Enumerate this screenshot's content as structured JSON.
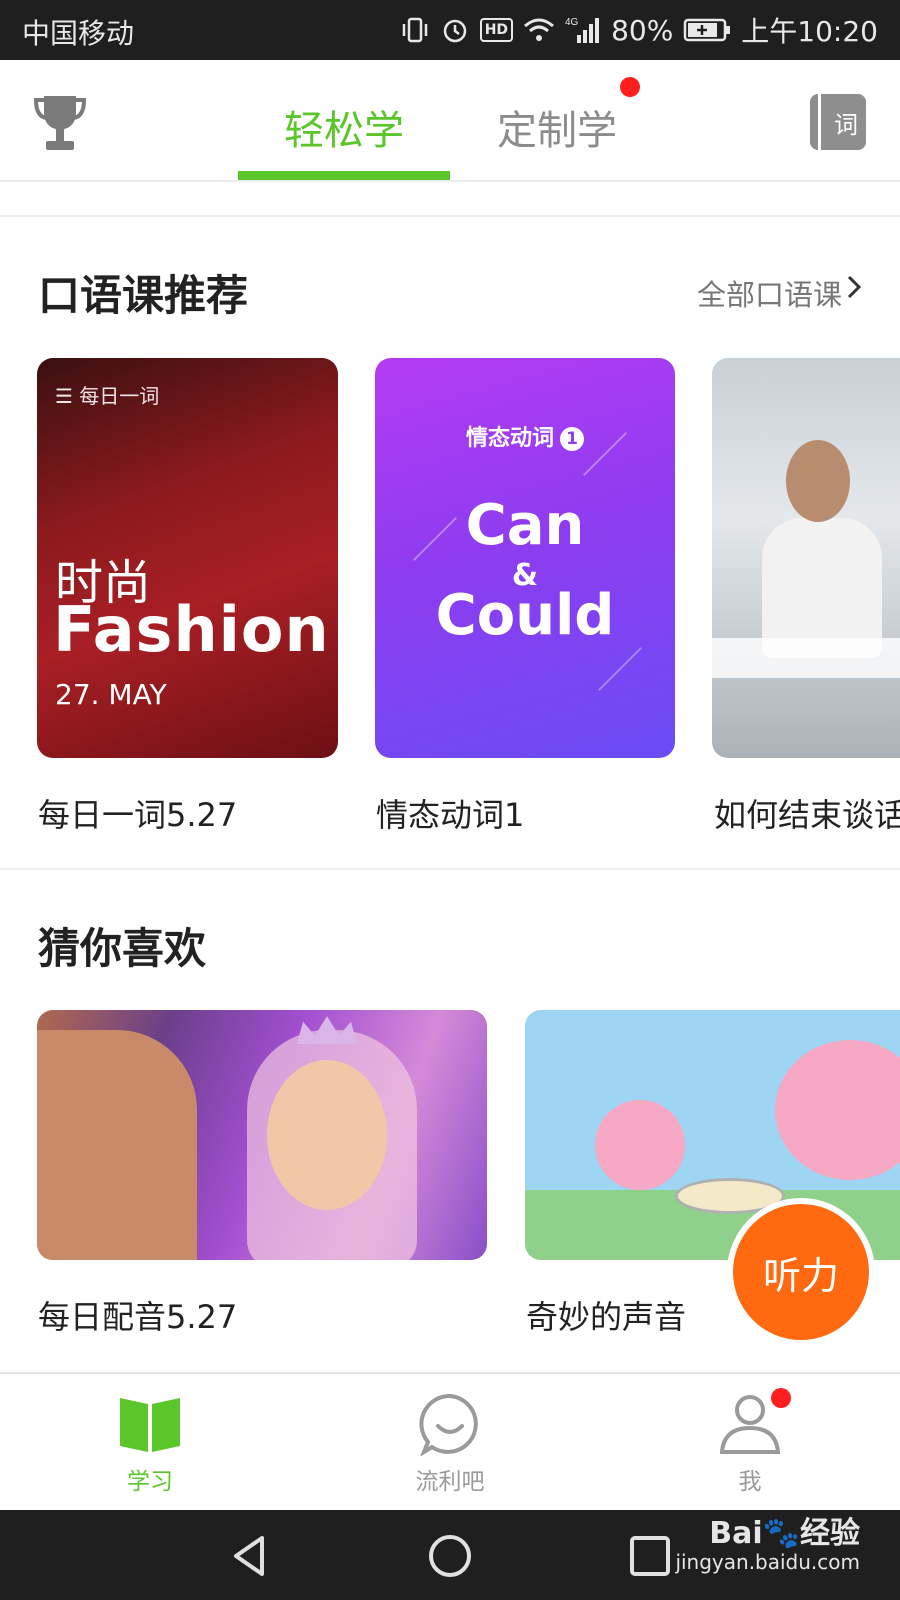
{
  "status_bar": {
    "carrier": "中国移动",
    "network": "4G",
    "hd": "HD",
    "battery": "80%",
    "time": "上午10:20"
  },
  "header": {
    "tabs": [
      {
        "label": "轻松学",
        "active": true
      },
      {
        "label": "定制学",
        "active": false,
        "has_badge": true
      }
    ],
    "vocab_button": "词"
  },
  "speaking_section": {
    "title": "口语课推荐",
    "all_link": "全部口语课",
    "cards": [
      {
        "caption": "每日一词5.27",
        "tag": "☰ 每日一词",
        "title_cn": "时尚",
        "title_en": "Fashion",
        "date": "27. MAY"
      },
      {
        "caption": "情态动词1",
        "tag": "情态动词",
        "tag_number": "1",
        "word1": "Can",
        "amp": "&",
        "word2": "Could"
      },
      {
        "caption": "如何结束谈话"
      }
    ]
  },
  "guess_section": {
    "title": "猜你喜欢",
    "cards": [
      {
        "caption": "每日配音5.27"
      },
      {
        "caption": "奇妙的声音"
      }
    ],
    "floating_button": "听力"
  },
  "bottom_nav": {
    "items": [
      {
        "label": "学习",
        "icon": "book-icon",
        "active": true
      },
      {
        "label": "流利吧",
        "icon": "chat-smile-icon",
        "active": false
      },
      {
        "label": "我",
        "icon": "user-icon",
        "active": false,
        "has_badge": true
      }
    ]
  },
  "watermark": {
    "main": "Bai🐾经验",
    "sub": "jingyan.baidu.com"
  },
  "colors": {
    "accent": "#5ac62a",
    "badge": "#ff1f1f",
    "listen": "#ff6a10",
    "purple": "#8f3cf0"
  }
}
